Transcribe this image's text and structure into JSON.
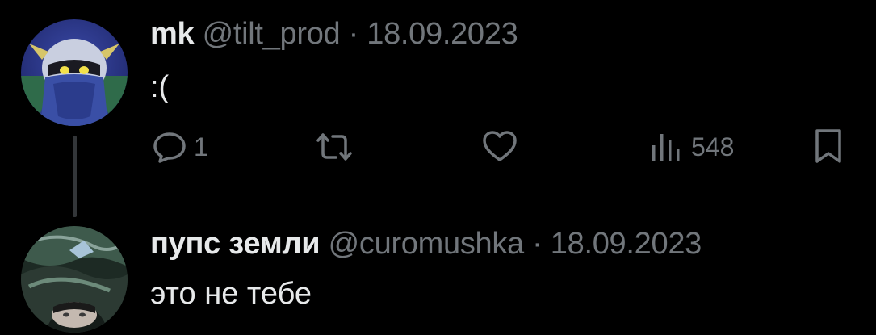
{
  "tweet1": {
    "display_name": "mk",
    "handle": "@tilt_prod",
    "separator": "·",
    "date": "18.09.2023",
    "text": ":(",
    "actions": {
      "reply_count": "1",
      "views_count": "548"
    }
  },
  "tweet2": {
    "display_name": "пупс земли",
    "handle": "@curomushka",
    "separator": "·",
    "date": "18.09.2023",
    "text": "это не тебе"
  },
  "colors": {
    "background": "#000000",
    "text_primary": "#e7e9ea",
    "text_secondary": "#71767b",
    "thread_line": "#333639"
  },
  "icons": [
    "reply-icon",
    "retweet-icon",
    "like-icon",
    "views-icon",
    "bookmark-icon"
  ]
}
